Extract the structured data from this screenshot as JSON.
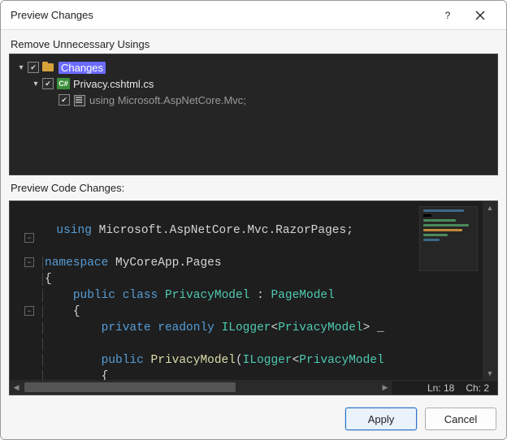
{
  "window": {
    "title": "Preview Changes"
  },
  "labels": {
    "remove_usings": "Remove Unnecessary Usings",
    "preview_code": "Preview Code Changes:"
  },
  "tree": {
    "root": {
      "label": "Changes"
    },
    "file": {
      "label": "Privacy.cshtml.cs",
      "icon_label": "C#"
    },
    "using_line": {
      "label": "using Microsoft.AspNetCore.Mvc;"
    }
  },
  "code": {
    "l1_using": "using",
    "l1_ns": " Microsoft.AspNetCore.Mvc.RazorPages",
    "l1_end": ";",
    "l3_ns_kw": "namespace",
    "l3_ns": " MyCoreApp.Pages",
    "l4_brace": "{",
    "l5_pub": "public",
    "l5_class": " class ",
    "l5_type": "PrivacyModel",
    "l5_colon": " : ",
    "l5_base": "PageModel",
    "l6_brace": "{",
    "l7_priv": "private",
    "l7_ro": " readonly ",
    "l7_ilog": "ILogger",
    "l7_lt": "<",
    "l7_gen": "PrivacyModel",
    "l7_gt": "> _",
    "l9_pub": "public",
    "l9_ctor": " PrivacyModel",
    "l9_open": "(",
    "l9_ilog": "ILogger",
    "l9_lt": "<",
    "l9_gen": "PrivacyModel",
    "l10_brace": "{"
  },
  "status": {
    "line": "Ln: 18",
    "col": "Ch: 2"
  },
  "buttons": {
    "apply": "Apply",
    "cancel": "Cancel"
  },
  "colors": {
    "accent": "#2a72c8",
    "highlight": "#6b6bff"
  }
}
